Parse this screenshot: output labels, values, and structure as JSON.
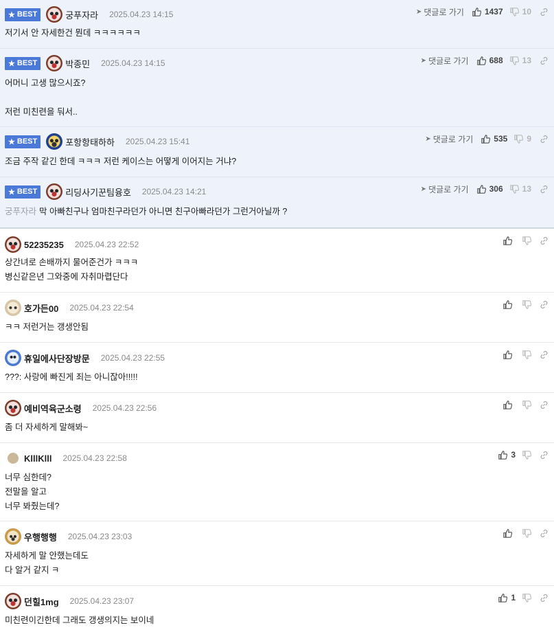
{
  "best_label": "BEST",
  "goto_label": "댓글로 가기",
  "best_comments": [
    {
      "nick": "궁푸자라",
      "date": "2025.04.23 14:15",
      "likes": "1437",
      "dislikes": "10",
      "lines": [
        "저기서 안 자세한건 뭔데 ㅋㅋㅋㅋㅋㅋ"
      ],
      "reply_to": ""
    },
    {
      "nick": "박종민",
      "date": "2025.04.23 14:15",
      "likes": "688",
      "dislikes": "13",
      "lines": [
        "어머니 고생 많으시죠?",
        "",
        "저런 미친련을 둬서.."
      ],
      "reply_to": ""
    },
    {
      "nick": "포항항태하하",
      "date": "2025.04.23 15:41",
      "likes": "535",
      "dislikes": "9",
      "lines": [
        "조금 주작 같긴 한데 ㅋㅋㅋ 저런 케이스는 어떻게 이어지는 거냐?"
      ],
      "reply_to": ""
    },
    {
      "nick": "리딩사기꾼팀융호",
      "date": "2025.04.23 14:21",
      "likes": "306",
      "dislikes": "13",
      "lines": [
        "막 아빠친구나 엄마친구라던가 아니면 친구아빠라던가 그런거아닐까 ?"
      ],
      "reply_to": "궁푸자라"
    }
  ],
  "comments": [
    {
      "nick": "52235235",
      "date": "2025.04.23 22:52",
      "likes": "",
      "lines": [
        "상간녀로 손배까지 물어준건가 ㅋㅋㅋ",
        "병신같은년 그와중에 자취마렵단다"
      ]
    },
    {
      "nick": "호가든00",
      "date": "2025.04.23 22:54",
      "likes": "",
      "lines": [
        "ㅋㅋ 저런거는 갱생안됨"
      ]
    },
    {
      "nick": "휴일에사단장방문",
      "date": "2025.04.23 22:55",
      "likes": "",
      "lines": [
        "???: 사랑에 빠진게 죄는 아니잖아!!!!!"
      ]
    },
    {
      "nick": "예비역육군소령",
      "date": "2025.04.23 22:56",
      "likes": "",
      "lines": [
        "좀 더 자세하게 말해봐~"
      ]
    },
    {
      "nick": "KlllKlll",
      "date": "2025.04.23 22:58",
      "likes": "3",
      "lines": [
        "너무 심한데?",
        "전말을 알고",
        "너무 봐줬는데?"
      ]
    },
    {
      "nick": "우행행행",
      "date": "2025.04.23 23:03",
      "likes": "",
      "lines": [
        "자세하게 말 안했는데도",
        "다 알거 같지 ㅋ"
      ]
    },
    {
      "nick": "던힐1mg",
      "date": "2025.04.23 23:07",
      "likes": "1",
      "lines": [
        "미친련이긴한데 그래도 갱생의지는 보이네"
      ]
    }
  ]
}
